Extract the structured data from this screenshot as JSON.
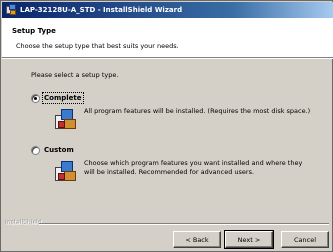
{
  "window": {
    "title": "LAP-32128U-A_STD - InstallShield Wizard"
  },
  "header": {
    "title": "Setup Type",
    "subtitle": "Choose the setup type that best suits your needs."
  },
  "prompt": "Please select a setup type.",
  "options": [
    {
      "label": "Complete",
      "selected": true,
      "description": "All program features will be installed. (Requires the most disk space.)",
      "icon": "setup-package-icon"
    },
    {
      "label": "Custom",
      "selected": false,
      "description": "Choose which program features you want installed and where they will be installed. Recommended for advanced users.",
      "icon": "setup-package-icon"
    }
  ],
  "footer": {
    "brand": "InstallShield",
    "back_label": "< Back",
    "next_label": "Next >",
    "cancel_label": "Cancel"
  }
}
